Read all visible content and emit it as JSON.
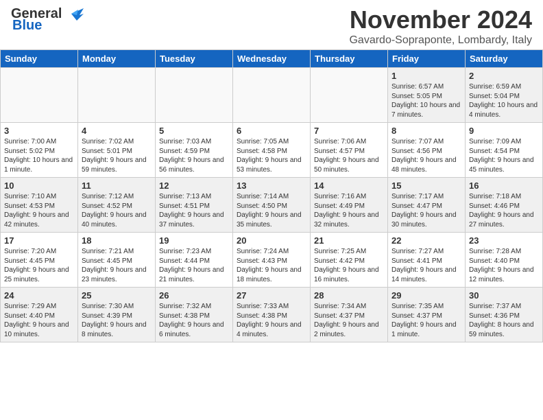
{
  "header": {
    "logo_general": "General",
    "logo_blue": "Blue",
    "month_title": "November 2024",
    "location": "Gavardo-Sopraponte, Lombardy, Italy"
  },
  "calendar": {
    "days_of_week": [
      "Sunday",
      "Monday",
      "Tuesday",
      "Wednesday",
      "Thursday",
      "Friday",
      "Saturday"
    ],
    "weeks": [
      [
        {
          "day": "",
          "info": ""
        },
        {
          "day": "",
          "info": ""
        },
        {
          "day": "",
          "info": ""
        },
        {
          "day": "",
          "info": ""
        },
        {
          "day": "",
          "info": ""
        },
        {
          "day": "1",
          "info": "Sunrise: 6:57 AM\nSunset: 5:05 PM\nDaylight: 10 hours and 7 minutes."
        },
        {
          "day": "2",
          "info": "Sunrise: 6:59 AM\nSunset: 5:04 PM\nDaylight: 10 hours and 4 minutes."
        }
      ],
      [
        {
          "day": "3",
          "info": "Sunrise: 7:00 AM\nSunset: 5:02 PM\nDaylight: 10 hours and 1 minute."
        },
        {
          "day": "4",
          "info": "Sunrise: 7:02 AM\nSunset: 5:01 PM\nDaylight: 9 hours and 59 minutes."
        },
        {
          "day": "5",
          "info": "Sunrise: 7:03 AM\nSunset: 4:59 PM\nDaylight: 9 hours and 56 minutes."
        },
        {
          "day": "6",
          "info": "Sunrise: 7:05 AM\nSunset: 4:58 PM\nDaylight: 9 hours and 53 minutes."
        },
        {
          "day": "7",
          "info": "Sunrise: 7:06 AM\nSunset: 4:57 PM\nDaylight: 9 hours and 50 minutes."
        },
        {
          "day": "8",
          "info": "Sunrise: 7:07 AM\nSunset: 4:56 PM\nDaylight: 9 hours and 48 minutes."
        },
        {
          "day": "9",
          "info": "Sunrise: 7:09 AM\nSunset: 4:54 PM\nDaylight: 9 hours and 45 minutes."
        }
      ],
      [
        {
          "day": "10",
          "info": "Sunrise: 7:10 AM\nSunset: 4:53 PM\nDaylight: 9 hours and 42 minutes."
        },
        {
          "day": "11",
          "info": "Sunrise: 7:12 AM\nSunset: 4:52 PM\nDaylight: 9 hours and 40 minutes."
        },
        {
          "day": "12",
          "info": "Sunrise: 7:13 AM\nSunset: 4:51 PM\nDaylight: 9 hours and 37 minutes."
        },
        {
          "day": "13",
          "info": "Sunrise: 7:14 AM\nSunset: 4:50 PM\nDaylight: 9 hours and 35 minutes."
        },
        {
          "day": "14",
          "info": "Sunrise: 7:16 AM\nSunset: 4:49 PM\nDaylight: 9 hours and 32 minutes."
        },
        {
          "day": "15",
          "info": "Sunrise: 7:17 AM\nSunset: 4:47 PM\nDaylight: 9 hours and 30 minutes."
        },
        {
          "day": "16",
          "info": "Sunrise: 7:18 AM\nSunset: 4:46 PM\nDaylight: 9 hours and 27 minutes."
        }
      ],
      [
        {
          "day": "17",
          "info": "Sunrise: 7:20 AM\nSunset: 4:45 PM\nDaylight: 9 hours and 25 minutes."
        },
        {
          "day": "18",
          "info": "Sunrise: 7:21 AM\nSunset: 4:45 PM\nDaylight: 9 hours and 23 minutes."
        },
        {
          "day": "19",
          "info": "Sunrise: 7:23 AM\nSunset: 4:44 PM\nDaylight: 9 hours and 21 minutes."
        },
        {
          "day": "20",
          "info": "Sunrise: 7:24 AM\nSunset: 4:43 PM\nDaylight: 9 hours and 18 minutes."
        },
        {
          "day": "21",
          "info": "Sunrise: 7:25 AM\nSunset: 4:42 PM\nDaylight: 9 hours and 16 minutes."
        },
        {
          "day": "22",
          "info": "Sunrise: 7:27 AM\nSunset: 4:41 PM\nDaylight: 9 hours and 14 minutes."
        },
        {
          "day": "23",
          "info": "Sunrise: 7:28 AM\nSunset: 4:40 PM\nDaylight: 9 hours and 12 minutes."
        }
      ],
      [
        {
          "day": "24",
          "info": "Sunrise: 7:29 AM\nSunset: 4:40 PM\nDaylight: 9 hours and 10 minutes."
        },
        {
          "day": "25",
          "info": "Sunrise: 7:30 AM\nSunset: 4:39 PM\nDaylight: 9 hours and 8 minutes."
        },
        {
          "day": "26",
          "info": "Sunrise: 7:32 AM\nSunset: 4:38 PM\nDaylight: 9 hours and 6 minutes."
        },
        {
          "day": "27",
          "info": "Sunrise: 7:33 AM\nSunset: 4:38 PM\nDaylight: 9 hours and 4 minutes."
        },
        {
          "day": "28",
          "info": "Sunrise: 7:34 AM\nSunset: 4:37 PM\nDaylight: 9 hours and 2 minutes."
        },
        {
          "day": "29",
          "info": "Sunrise: 7:35 AM\nSunset: 4:37 PM\nDaylight: 9 hours and 1 minute."
        },
        {
          "day": "30",
          "info": "Sunrise: 7:37 AM\nSunset: 4:36 PM\nDaylight: 8 hours and 59 minutes."
        }
      ]
    ]
  }
}
